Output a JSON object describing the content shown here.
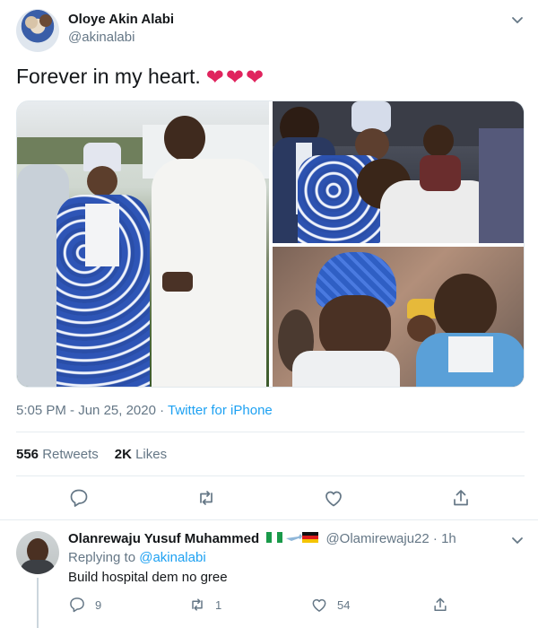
{
  "tweet": {
    "display_name": "Oloye Akin Alabi",
    "handle": "@akinalabi",
    "text": "Forever in my heart.",
    "emoji": "❤❤❤",
    "time": "5:05 PM",
    "date": "Jun 25, 2020",
    "separator": "·",
    "source": "Twitter for iPhone",
    "retweets_count": "556",
    "retweets_label": "Retweets",
    "likes_count": "2K",
    "likes_label": "Likes",
    "media_alt": "Photo collage of men in traditional Nigerian attire at an outdoor event"
  },
  "actions": [
    "reply-icon",
    "retweet-icon",
    "like-icon",
    "share-icon"
  ],
  "reply": {
    "display_name": "Olanrewaju Yusuf Muhammed",
    "name_emoji": "🇳🇬✈🇩🇪",
    "handle": "@Olamirewaju22",
    "separator": "·",
    "age": "1h",
    "replying_prefix": "Replying to",
    "replying_to": "@akinalabi",
    "text": "Build hospital dem no gree",
    "reply_count": "9",
    "retweet_count": "1",
    "like_count": "54"
  },
  "colors": {
    "accent": "#1da1f2",
    "secondary_text": "#657786",
    "heart": "#e0245e"
  }
}
